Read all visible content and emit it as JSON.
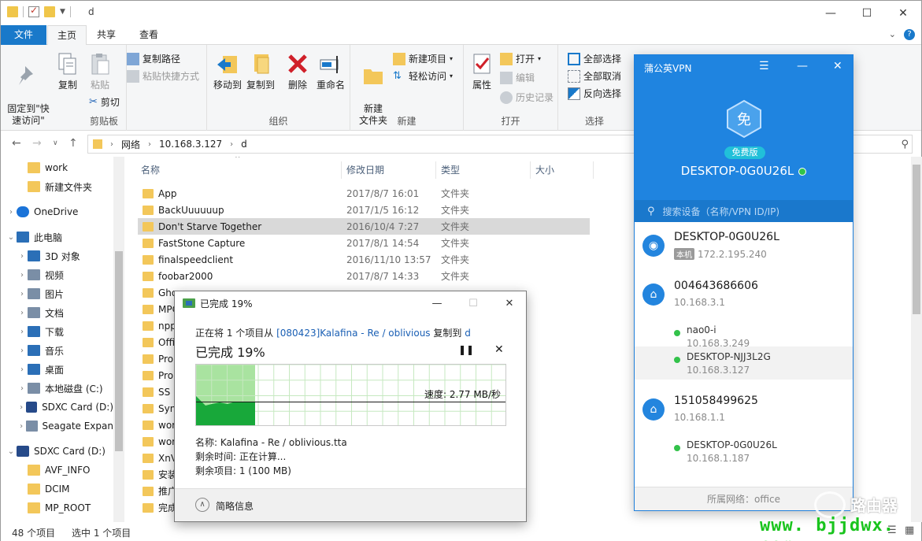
{
  "explorer": {
    "title_path": "d",
    "tabs": {
      "file": "文件",
      "home": "主页",
      "share": "共享",
      "view": "查看"
    },
    "ribbon": {
      "clipboard": {
        "label": "剪贴板",
        "pin": "固定到\"快\n速访问\"",
        "copy": "复制",
        "paste": "粘贴",
        "copy_path": "复制路径",
        "paste_shortcut": "粘贴快捷方式",
        "cut": "剪切"
      },
      "organize": {
        "label": "组织",
        "move_to": "移动到",
        "copy_to": "复制到",
        "delete": "删除",
        "rename": "重命名"
      },
      "new": {
        "label": "新建",
        "new_folder": "新建\n文件夹",
        "new_item": "新建项目",
        "easy_access": "轻松访问"
      },
      "open": {
        "label": "打开",
        "properties": "属性",
        "open": "打开",
        "edit": "编辑",
        "history": "历史记录"
      },
      "select": {
        "label": "选择",
        "select_all": "全部选择",
        "select_none": "全部取消",
        "invert": "反向选择"
      }
    },
    "address": {
      "segments": [
        "网络",
        "10.168.3.127",
        "d"
      ]
    },
    "nav_items": [
      {
        "label": "work",
        "icon": "folder-icon",
        "indent": 1
      },
      {
        "label": "新建文件夹",
        "icon": "folder-icon",
        "indent": 1
      },
      {
        "label": "OneDrive",
        "icon": "cloud-icon",
        "indent": 0
      },
      {
        "label": "此电脑",
        "icon": "pc-icon",
        "indent": 0,
        "expanded": true
      },
      {
        "label": "3D 对象",
        "icon": "3d-objects-icon",
        "indent": 1
      },
      {
        "label": "视频",
        "icon": "video-icon",
        "indent": 1
      },
      {
        "label": "图片",
        "icon": "pictures-icon",
        "indent": 1
      },
      {
        "label": "文档",
        "icon": "documents-icon",
        "indent": 1
      },
      {
        "label": "下载",
        "icon": "downloads-icon",
        "indent": 1
      },
      {
        "label": "音乐",
        "icon": "music-icon",
        "indent": 1
      },
      {
        "label": "桌面",
        "icon": "desktop-icon",
        "indent": 1
      },
      {
        "label": "本地磁盘 (C:)",
        "icon": "local-disk-icon",
        "indent": 1
      },
      {
        "label": "SDXC Card (D:)",
        "icon": "sd-card-icon",
        "indent": 1
      },
      {
        "label": "Seagate Expan",
        "icon": "external-drive-icon",
        "indent": 1
      },
      {
        "label": "SDXC Card (D:)",
        "icon": "sd-card-icon",
        "indent": 0,
        "expanded": true
      },
      {
        "label": "AVF_INFO",
        "icon": "folder-icon",
        "indent": 1
      },
      {
        "label": "DCIM",
        "icon": "folder-icon",
        "indent": 1
      },
      {
        "label": "MP_ROOT",
        "icon": "folder-icon",
        "indent": 1
      }
    ],
    "columns": {
      "name": "名称",
      "date": "修改日期",
      "type": "类型",
      "size": "大小"
    },
    "files": [
      {
        "name": "App",
        "date": "2017/8/7 16:01",
        "type": "文件夹"
      },
      {
        "name": "BackUuuuuup",
        "date": "2017/1/5 16:12",
        "type": "文件夹"
      },
      {
        "name": "Don't Starve Together",
        "date": "2016/10/4 7:27",
        "type": "文件夹",
        "selected": true
      },
      {
        "name": "FastStone Capture",
        "date": "2017/8/1 14:54",
        "type": "文件夹"
      },
      {
        "name": "finalspeedclient",
        "date": "2016/11/10 13:57",
        "type": "文件夹"
      },
      {
        "name": "foobar2000",
        "date": "2017/8/7 14:33",
        "type": "文件夹"
      },
      {
        "name": "Ghos",
        "date": "",
        "type": ""
      },
      {
        "name": "MPC",
        "date": "",
        "type": ""
      },
      {
        "name": "npp",
        "date": "",
        "type": ""
      },
      {
        "name": "Offi",
        "date": "",
        "type": ""
      },
      {
        "name": "Pro",
        "date": "",
        "type": ""
      },
      {
        "name": "Pro",
        "date": "",
        "type": ""
      },
      {
        "name": "SS",
        "date": "",
        "type": ""
      },
      {
        "name": "Syn",
        "date": "",
        "type": ""
      },
      {
        "name": "wor",
        "date": "",
        "type": ""
      },
      {
        "name": "wor",
        "date": "",
        "type": ""
      },
      {
        "name": "XnV",
        "date": "",
        "type": ""
      },
      {
        "name": "安装",
        "date": "",
        "type": ""
      },
      {
        "name": "推广",
        "date": "",
        "type": ""
      },
      {
        "name": "完成",
        "date": "",
        "type": ""
      }
    ],
    "status": {
      "count": "48 个项目",
      "selected": "选中 1 个项目"
    }
  },
  "copy_dialog": {
    "title": "已完成 19%",
    "line_prefix": "正在将 1 个项目从 ",
    "source": "[080423]Kalafina - Re / oblivious",
    "line_mid": " 复制到 ",
    "dest": "d",
    "progress_label": "已完成 19%",
    "progress_fraction": 0.19,
    "speed": "速度: 2.77 MB/秒",
    "name_line": "名称: Kalafina - Re / oblivious.tta",
    "remaining_time": "剩余时间: 正在计算...",
    "remaining_items": "剩余项目: 1 (100 MB)",
    "less_details": "简略信息",
    "colors": {
      "fill": "#a9e3a0",
      "dark": "#18a83a"
    }
  },
  "vpn": {
    "title": "蒲公英VPN",
    "badge_char": "免",
    "edition": "免费版",
    "hostname": "DESKTOP-0G0U26L",
    "search_placeholder": "搜索设备（名称/VPN ID/IP)",
    "devices": [
      {
        "name": "DESKTOP-0G0U26L",
        "tag": "本机",
        "ip": "172.2.195.240",
        "icon": "user-icon"
      },
      {
        "name": "004643686606",
        "ip": "10.168.3.1",
        "icon": "router-icon",
        "children": [
          {
            "name": "nao0-i",
            "ip": "10.168.3.249"
          },
          {
            "name": "DESKTOP-NJJ3L2G",
            "ip": "10.168.3.127",
            "highlight": true
          }
        ]
      },
      {
        "name": "151058499625",
        "ip": "10.168.1.1",
        "icon": "router-icon",
        "children": [
          {
            "name": "DESKTOP-0G0U26L",
            "ip": "10.168.1.187"
          }
        ]
      }
    ],
    "network_label": "所属网络：office",
    "colors": {
      "header": "#1f84e0",
      "online": "#33c24a"
    }
  },
  "watermark": {
    "domain": "www. bjjdwx. com",
    "brand": "路由器"
  }
}
